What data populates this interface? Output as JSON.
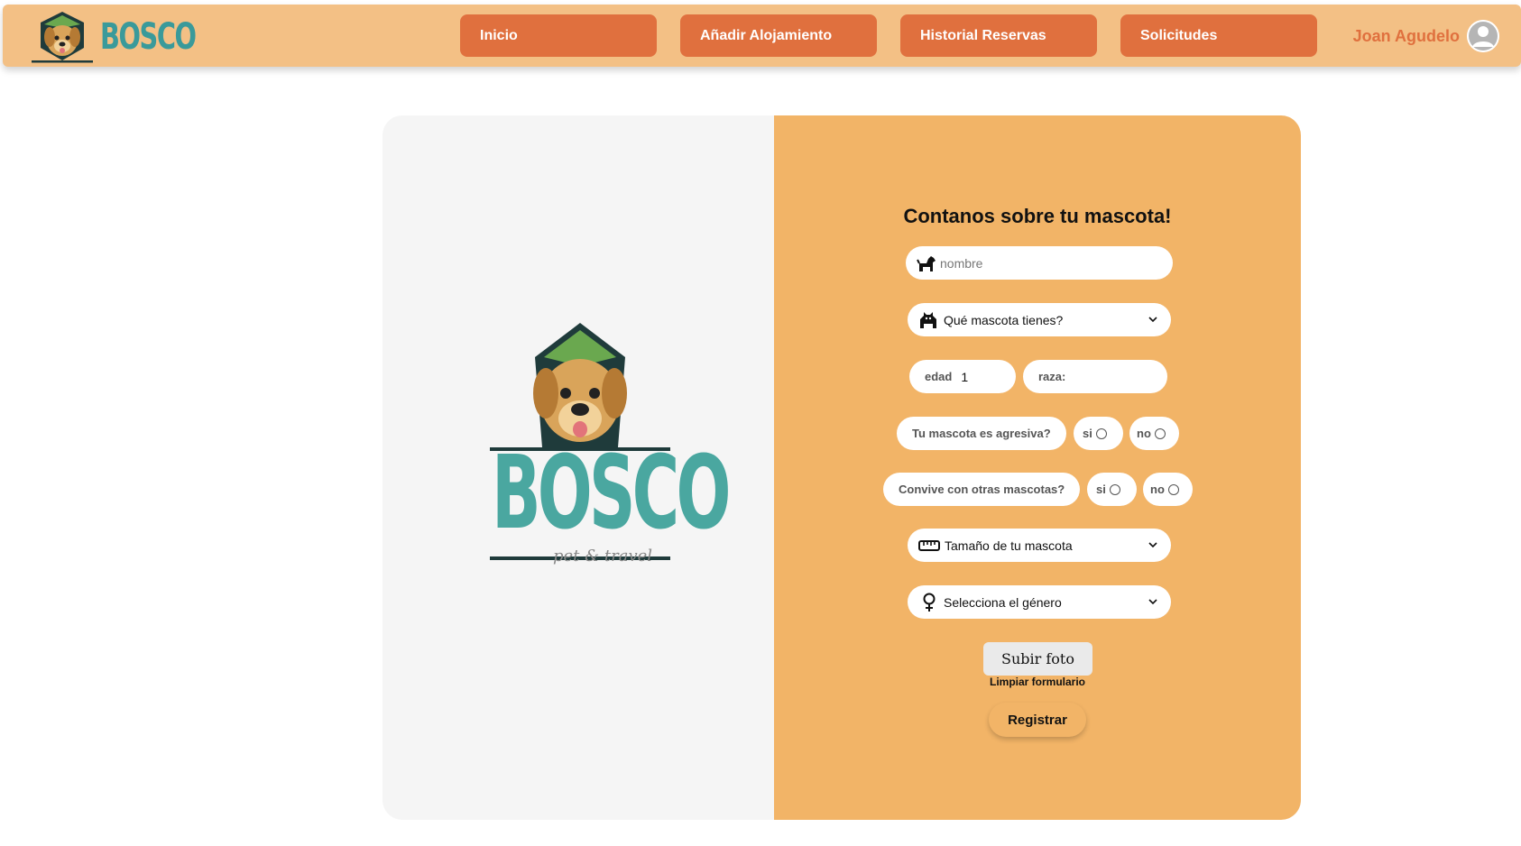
{
  "header": {
    "brand": "BOSCO",
    "nav": [
      {
        "label": "Inicio"
      },
      {
        "label": "Añadir Alojamiento"
      },
      {
        "label": "Historial Reservas"
      },
      {
        "label": "Solicitudes"
      }
    ],
    "user_name": "Joan Agudelo"
  },
  "logo": {
    "word": "BOSCO",
    "subtitle": "pet & travel"
  },
  "form": {
    "title": "Contanos sobre tu mascota!",
    "name_placeholder": "nombre",
    "pet_type_select": "Qué mascota tienes?",
    "age_label": "edad",
    "age_value": "1",
    "breed_label": "raza:",
    "aggressive_question": "Tu mascota es agresiva?",
    "coexist_question": "Convive con otras mascotas?",
    "yes": "si",
    "no": "no",
    "size_select": "Tamaño de tu mascota",
    "gender_select": "Selecciona el género",
    "upload_button": "Subir foto",
    "clear_link": "Limpiar formulario",
    "submit_button": "Registrar"
  },
  "colors": {
    "header_bg": "#f3c085",
    "nav_button": "#e0703e",
    "form_bg": "#f2b467",
    "logo_teal": "#4aa7a0"
  }
}
